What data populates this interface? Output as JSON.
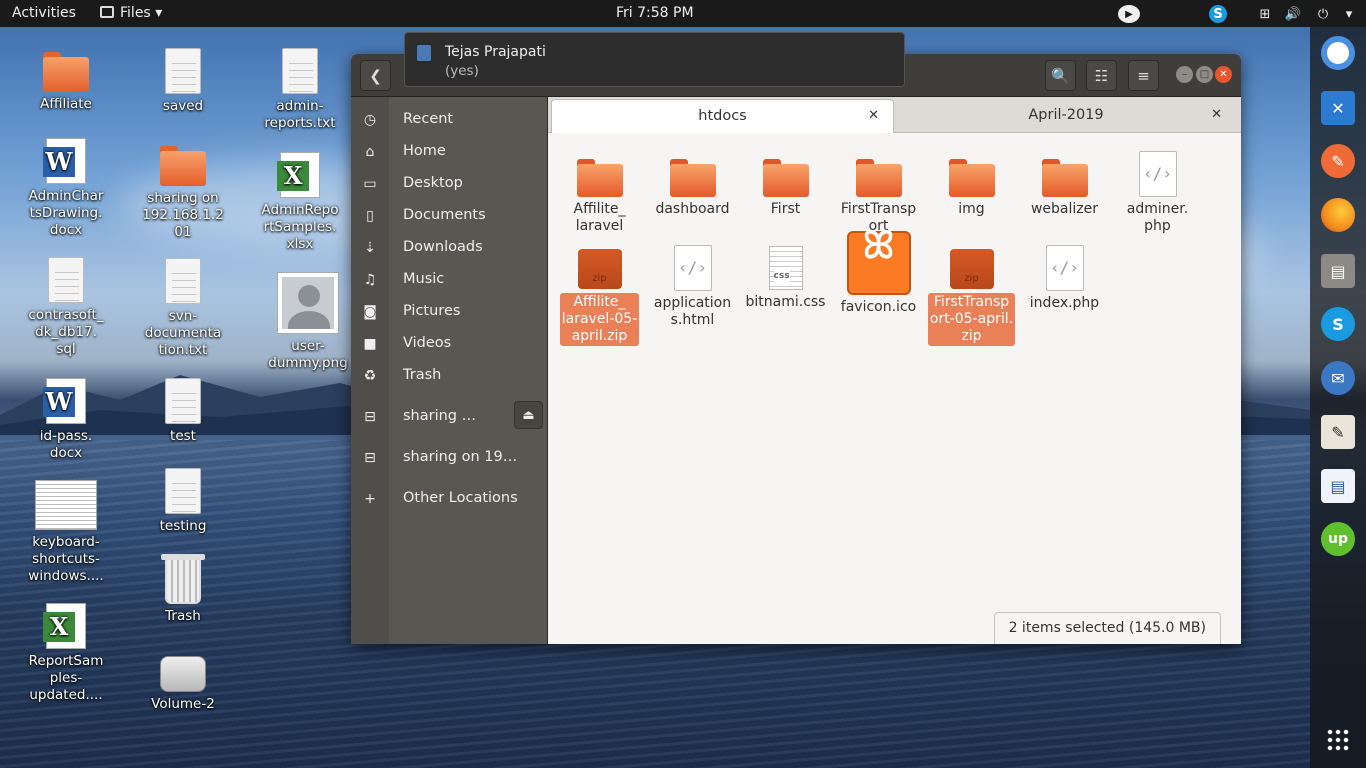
{
  "topbar": {
    "activities": "Activities",
    "app_menu": "Files",
    "clock": "Fri  7:58 PM"
  },
  "desktop": {
    "icons": [
      {
        "label": "Affiliate",
        "type": "folder"
      },
      {
        "label": "AdminChar\ntsDrawing.\ndocx",
        "type": "word"
      },
      {
        "label": "contrasoft_\ndk_db17.\nsql",
        "type": "doc"
      },
      {
        "label": "id-pass.\ndocx",
        "type": "word"
      },
      {
        "label": "keyboard-\nshortcuts-\nwindows....",
        "type": "doc"
      },
      {
        "label": "ReportSam\nples-\nupdated....",
        "type": "excel"
      },
      {
        "label": "saved",
        "type": "doc"
      },
      {
        "label": "sharing on\n192.168.1.2\n01",
        "type": "folder"
      },
      {
        "label": "svn-\ndocumenta\ntion.txt",
        "type": "doc"
      },
      {
        "label": "test",
        "type": "doc"
      },
      {
        "label": "testing",
        "type": "doc"
      },
      {
        "label": "Trash",
        "type": "trash"
      },
      {
        "label": "Volume-2",
        "type": "drive"
      },
      {
        "label": "admin-\nreports.txt",
        "type": "doc"
      },
      {
        "label": "AdminRepo\nrtSamples.\nxlsx",
        "type": "excel"
      },
      {
        "label": "user-\ndummy.png",
        "type": "image"
      }
    ]
  },
  "notification": {
    "title": "Tejas Prajapati",
    "body": "(yes)"
  },
  "window": {
    "sidebar": [
      {
        "label": "Recent",
        "icon": "clock-icon"
      },
      {
        "label": "Home",
        "icon": "home-icon"
      },
      {
        "label": "Desktop",
        "icon": "desktop-folder-icon"
      },
      {
        "label": "Documents",
        "icon": "document-icon"
      },
      {
        "label": "Downloads",
        "icon": "download-icon"
      },
      {
        "label": "Music",
        "icon": "music-icon"
      },
      {
        "label": "Pictures",
        "icon": "camera-icon"
      },
      {
        "label": "Videos",
        "icon": "video-icon"
      },
      {
        "label": "Trash",
        "icon": "trash-icon"
      },
      {
        "label": "sharing …",
        "icon": "network-share-icon"
      },
      {
        "label": "sharing on 19…",
        "icon": "network-share-icon"
      },
      {
        "label": "Other Locations",
        "icon": "plus-icon"
      }
    ],
    "tabs": [
      {
        "label": "htdocs",
        "active": true
      },
      {
        "label": "April-2019",
        "active": false
      }
    ],
    "files": [
      {
        "label": "Affilite_\nlaravel",
        "type": "folder",
        "selected": false
      },
      {
        "label": "dashboard",
        "type": "folder",
        "selected": false
      },
      {
        "label": "First",
        "type": "folder",
        "selected": false
      },
      {
        "label": "FirstTransp\nort",
        "type": "folder",
        "selected": false
      },
      {
        "label": "img",
        "type": "folder",
        "selected": false
      },
      {
        "label": "webalizer",
        "type": "folder",
        "selected": false
      },
      {
        "label": "adminer.\nphp",
        "type": "code",
        "selected": false
      },
      {
        "label": "Affilite_\nlaravel-05-\napril.zip",
        "type": "zip",
        "selected": true
      },
      {
        "label": "application\ns.html",
        "type": "code",
        "selected": false
      },
      {
        "label": "bitnami.css",
        "type": "css",
        "selected": false
      },
      {
        "label": "favicon.ico",
        "type": "xampp",
        "selected": false
      },
      {
        "label": "FirstTransp\nort-05-april.\nzip",
        "type": "zip",
        "selected": true
      },
      {
        "label": "index.php",
        "type": "code",
        "selected": false
      }
    ],
    "status": "2 items selected  (145.0 MB)",
    "zip_badge": "zip",
    "css_badge": "css"
  },
  "dock": [
    {
      "name": "chrome",
      "color": "#4a8fe0"
    },
    {
      "name": "vscode",
      "color": "#2b7bd1"
    },
    {
      "name": "postman",
      "color": "#f06a35"
    },
    {
      "name": "firefox",
      "color": "#f28b1d"
    },
    {
      "name": "files",
      "color": "#8d8a85"
    },
    {
      "name": "skype",
      "color": "#1a9ae0"
    },
    {
      "name": "thunderbird",
      "color": "#3b78c4"
    },
    {
      "name": "text-editor",
      "color": "#e8e4d8"
    },
    {
      "name": "libreoffice-writer",
      "color": "#f0f4fa"
    },
    {
      "name": "upwork",
      "color": "#5fbf2d"
    }
  ],
  "colors": {
    "accent": "#e95420",
    "selection": "#ea8058",
    "sidebar": "#585752",
    "headerbar": "#3f3e3a"
  }
}
